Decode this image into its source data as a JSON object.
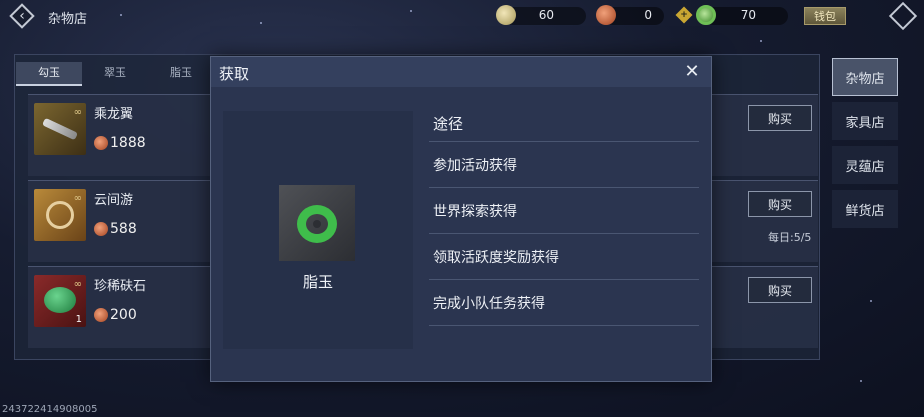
{
  "header": {
    "title": "杂物店",
    "currencies": [
      {
        "icon": "jade-coin-icon",
        "value": "60"
      },
      {
        "icon": "copper-coin-icon",
        "value": "0"
      },
      {
        "icon": "green-jade-icon",
        "value": "70"
      }
    ],
    "wallet_label": "钱包"
  },
  "tabs": [
    {
      "label": "勾玉",
      "active": true
    },
    {
      "label": "翠玉",
      "active": false
    },
    {
      "label": "脂玉",
      "active": false
    }
  ],
  "items": [
    {
      "name": "乘龙翼",
      "price": "1888",
      "buy_label": "购买",
      "daily": ""
    },
    {
      "name": "云间游",
      "price": "588",
      "buy_label": "购买",
      "daily": "每日:5/5"
    },
    {
      "name": "珍稀砆石",
      "price": "200",
      "buy_label": "购买",
      "daily": "",
      "count": "1"
    }
  ],
  "side_nav": [
    {
      "label": "杂物店",
      "active": true
    },
    {
      "label": "家具店",
      "active": false
    },
    {
      "label": "灵蕴店",
      "active": false
    },
    {
      "label": "鲜货店",
      "active": false
    }
  ],
  "modal": {
    "title": "获取",
    "item_name": "脂玉",
    "route_header": "途径",
    "routes": [
      "参加活动获得",
      "世界探索获得",
      "领取活跃度奖励获得",
      "完成小队任务获得"
    ]
  },
  "footer": {
    "uid": "243722414908005"
  }
}
